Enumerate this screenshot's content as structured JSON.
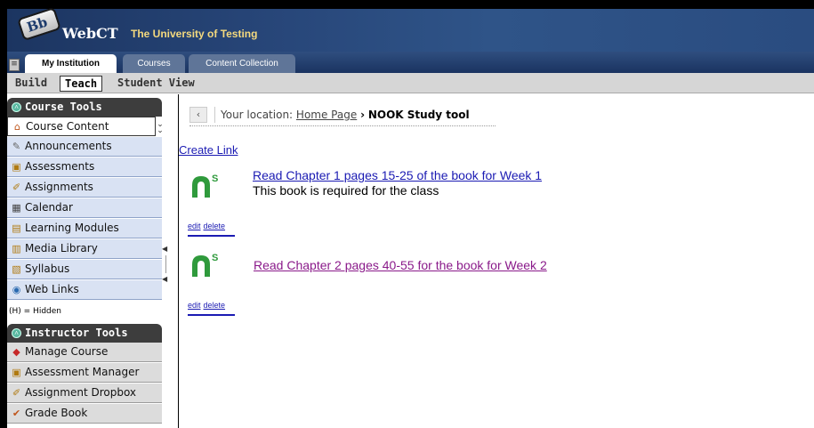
{
  "header": {
    "logo_text": "Bb",
    "brand": "WebCT",
    "institution": "The University of Testing"
  },
  "tabs": [
    {
      "label": "My Institution",
      "active": true
    },
    {
      "label": "Courses",
      "active": false
    },
    {
      "label": "Content Collection",
      "active": false
    }
  ],
  "modes": {
    "build": "Build",
    "teach": "Teach",
    "student_view": "Student View",
    "active": "Teach"
  },
  "sidebar": {
    "course_tools": {
      "title": "Course Tools",
      "items": [
        {
          "label": "Course Content",
          "icon": "home-icon"
        },
        {
          "label": "Announcements",
          "icon": "announcement-icon"
        },
        {
          "label": "Assessments",
          "icon": "assessment-icon"
        },
        {
          "label": "Assignments",
          "icon": "assignment-icon"
        },
        {
          "label": "Calendar",
          "icon": "calendar-icon"
        },
        {
          "label": "Learning Modules",
          "icon": "module-icon"
        },
        {
          "label": "Media Library",
          "icon": "media-icon"
        },
        {
          "label": "Syllabus",
          "icon": "syllabus-icon"
        },
        {
          "label": "Web Links",
          "icon": "weblink-icon"
        }
      ]
    },
    "hidden_note": "(H) = Hidden",
    "instructor_tools": {
      "title": "Instructor Tools",
      "items": [
        {
          "label": "Manage Course",
          "icon": "manage-icon"
        },
        {
          "label": "Assessment Manager",
          "icon": "assessment-manager-icon"
        },
        {
          "label": "Assignment Dropbox",
          "icon": "dropbox-icon"
        },
        {
          "label": "Grade Book",
          "icon": "gradebook-icon"
        }
      ]
    }
  },
  "breadcrumb": {
    "prefix": "Your location:",
    "home": "Home Page",
    "separator": "›",
    "current": "NOOK Study tool"
  },
  "main": {
    "create_link": "Create Link",
    "entries": [
      {
        "title": "Read Chapter 1 pages 15-25 of the book for Week 1",
        "description": "This book is required for the class",
        "edit": "edit",
        "delete": "delete"
      },
      {
        "title": "Read Chapter 2 pages 40-55 for the book for Week 2",
        "description": "",
        "edit": "edit",
        "delete": "delete"
      }
    ]
  },
  "colors": {
    "link": "#1b1bb3",
    "visited_link": "#8a1a8a",
    "nook_green": "#2f9a3c",
    "sidebar_item_bg": "#d9e2f3",
    "header_blue": "#28477a"
  }
}
